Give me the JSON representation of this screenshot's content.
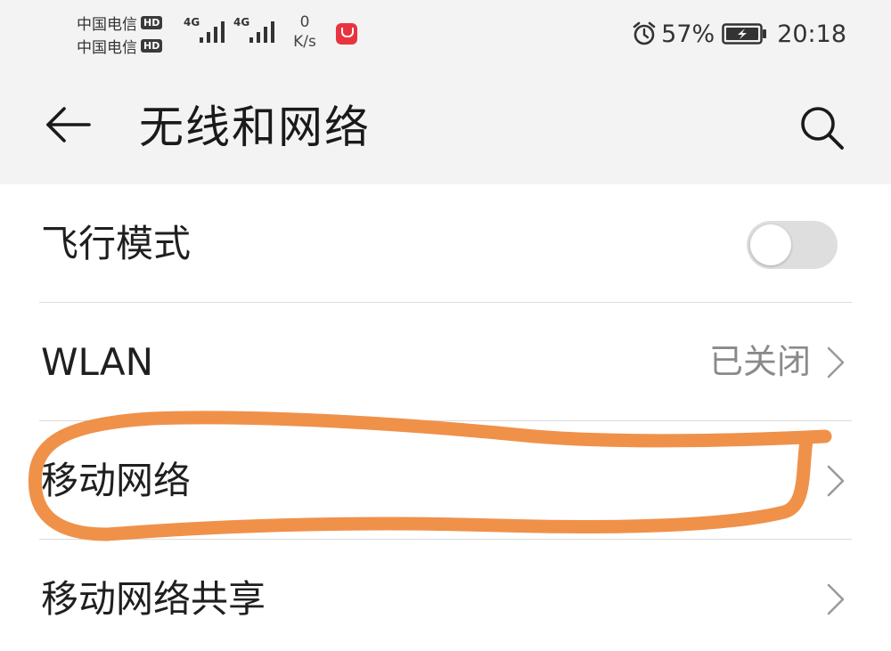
{
  "status_bar": {
    "carriers": [
      {
        "name": "中国电信",
        "badge": "HD"
      },
      {
        "name": "中国电信",
        "badge": "HD"
      }
    ],
    "signals": [
      {
        "type": "4G"
      },
      {
        "type": "4G"
      }
    ],
    "speed_value": "0",
    "speed_unit": "K/s",
    "battery_percent": "57%",
    "time": "20:18",
    "icons": [
      "alarm-icon",
      "battery-charging-icon",
      "app-notification-icon"
    ]
  },
  "header": {
    "title": "无线和网络",
    "back_icon": "arrow-left-icon",
    "search_icon": "search-icon"
  },
  "list": {
    "items": [
      {
        "label": "飞行模式",
        "control": "toggle",
        "toggle_on": false
      },
      {
        "label": "WLAN",
        "value": "已关闭",
        "control": "chevron"
      },
      {
        "label": "移动网络",
        "control": "chevron",
        "annotated": true
      },
      {
        "label": "移动网络共享",
        "control": "chevron"
      }
    ]
  },
  "annotation": {
    "color": "#f0914a",
    "target": "移动网络"
  },
  "colors": {
    "header_bg": "#f3f3f3",
    "toggle_off": "#dedede",
    "secondary_text": "#8a8a8a",
    "divider": "#dcdcdc"
  }
}
